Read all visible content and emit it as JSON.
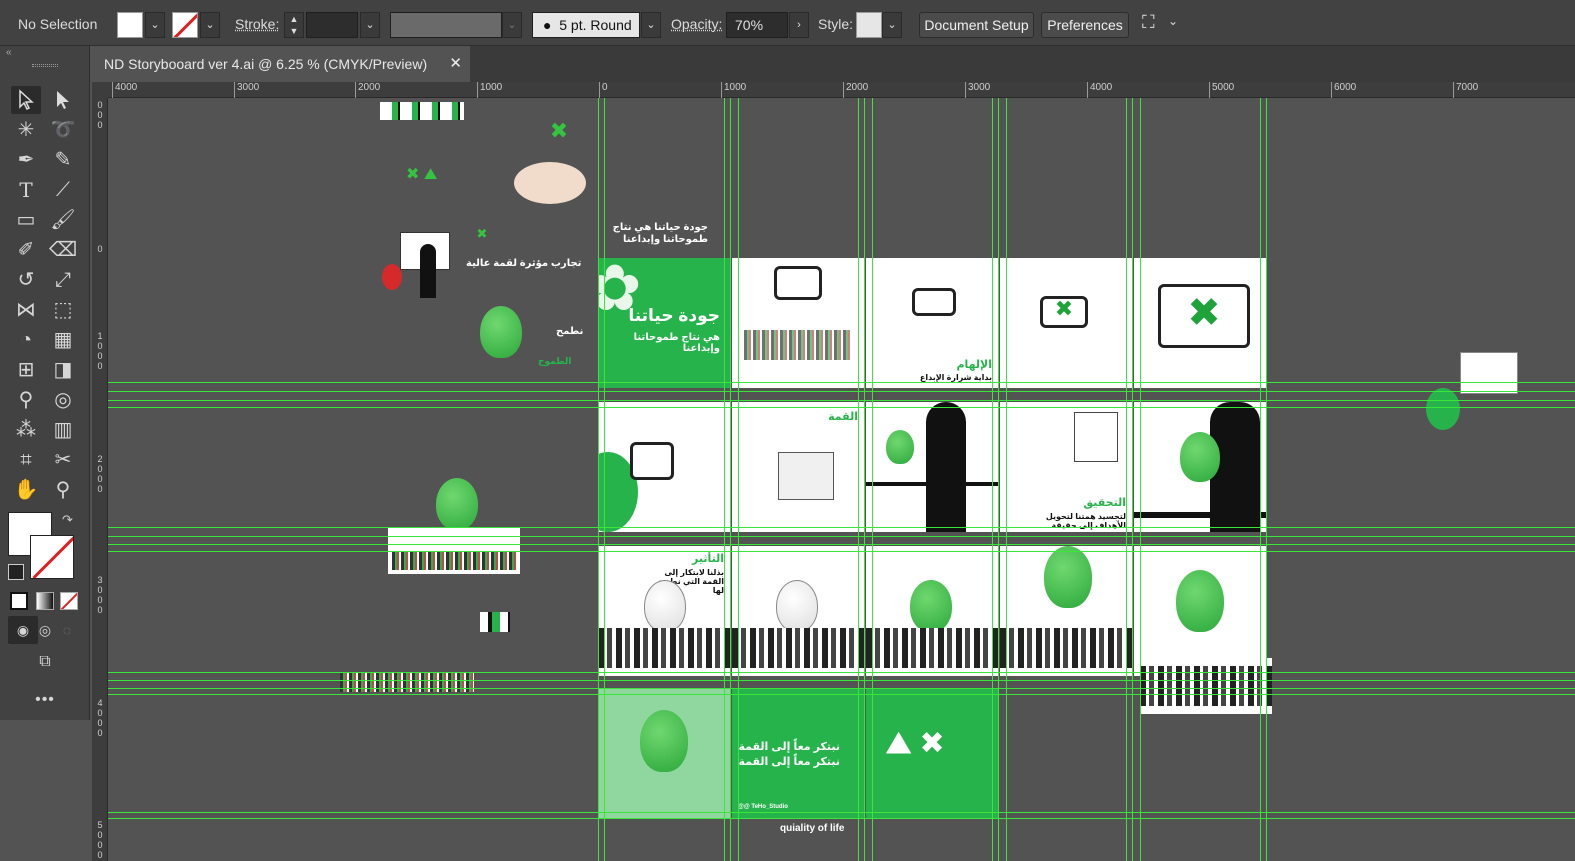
{
  "control_bar": {
    "selection": "No Selection",
    "stroke_label": "Stroke:",
    "brush": "5 pt. Round",
    "opacity_label": "Opacity:",
    "opacity_value": "70%",
    "style_label": "Style:",
    "document_setup": "Document Setup",
    "preferences": "Preferences"
  },
  "document": {
    "tab_title": "ND Storybooard ver 4.ai @ 6.25 % (CMYK/Preview)",
    "close": "✕"
  },
  "ruler": {
    "h_ticks": [
      "4000",
      "3000",
      "2000",
      "1000",
      "0",
      "1000",
      "2000",
      "3000",
      "4000",
      "5000",
      "6000",
      "7000"
    ],
    "v_ticks": [
      "0\n0\n0",
      "0",
      "1\n0\n0\n0",
      "2\n0\n0\n0",
      "3\n0\n0\n0",
      "4\n0\n0\n0",
      "5\n0\n0\n0"
    ]
  },
  "artwork": {
    "title_main": "جودة حياتنا",
    "subtitle": "هي نتاج طموحاتنا وإبداعنا",
    "top_caption_1": "جودة حياتنا هي نتاج",
    "top_caption_2": "طموحاتنا وإبداعنا",
    "experiences": "تجارب مؤثرة لقمة عالية",
    "aspire": "نطمح",
    "ambition": "الطموح",
    "inspiration": "الإلهام",
    "inspiration_sub": "بداية شرارة الإبداع",
    "summit": "القمة",
    "achievement": "التحقيق",
    "achievement_sub": "لتجسيد همتنا لتحويل الأهداف إلى حقيقة",
    "impact": "التأثير",
    "impact_sub": "بذلنا لابتكار إلى القمة التي نطمح لها",
    "innovate": "نبتكر معاً إلى القمة",
    "quality_of_life": "quiality of life",
    "handle": "@@ TeHo_Studio"
  },
  "colors": {
    "accent_green": "#27b34b",
    "guide_green": "#39e639",
    "panel_bg": "#424242"
  }
}
